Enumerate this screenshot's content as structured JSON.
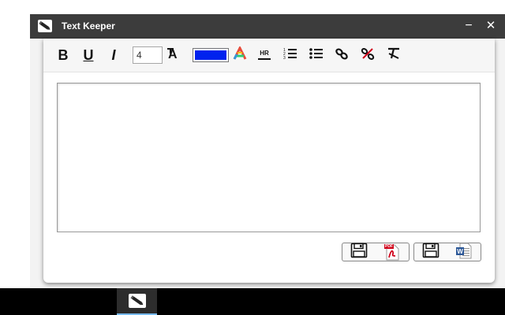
{
  "window": {
    "title": "Text Keeper",
    "app_icon": "pencil-icon",
    "minimize_glyph": "−",
    "close_glyph": "✕"
  },
  "toolbar": {
    "bold_label": "B",
    "underline_label": "U",
    "italic_label": "I",
    "font_size_value": "4",
    "text_color": "#0022ee",
    "buttons": [
      {
        "name": "font-size-icon"
      },
      {
        "name": "text-color-icon"
      },
      {
        "name": "horizontal-rule-icon",
        "label": "HR"
      },
      {
        "name": "numbered-list-icon"
      },
      {
        "name": "bullet-list-icon"
      },
      {
        "name": "link-icon"
      },
      {
        "name": "unlink-icon"
      },
      {
        "name": "clear-format-icon"
      }
    ]
  },
  "editor": {
    "content": ""
  },
  "save_buttons": [
    {
      "name": "save-pdf-button",
      "icons": [
        "floppy-disk-icon",
        "pdf-file-icon"
      ],
      "badge": "PDF"
    },
    {
      "name": "save-word-button",
      "icons": [
        "floppy-disk-icon",
        "word-file-icon"
      ]
    }
  ],
  "taskbar": {
    "items": [
      {
        "name": "text-keeper-task",
        "icon": "pencil-icon",
        "active": true
      }
    ]
  },
  "colors": {
    "titlebar": "#3c3c3c",
    "taskbar": "#000000",
    "accent": "#0022ee",
    "task_highlight": "#76b9ed"
  }
}
